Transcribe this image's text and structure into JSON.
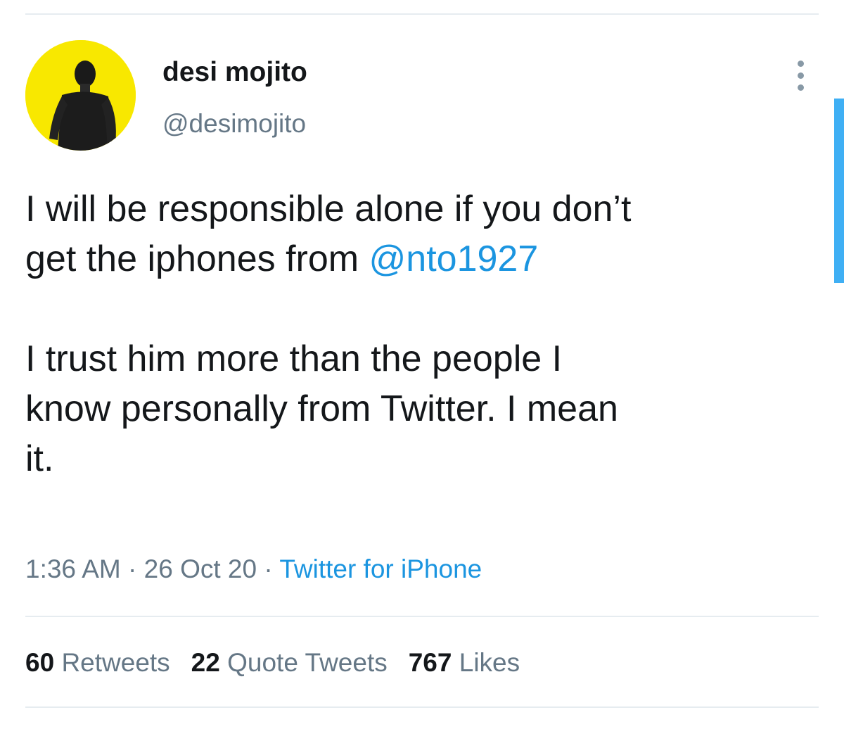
{
  "author": {
    "display_name": "desi mojito",
    "handle": "@desimojito",
    "avatar_icon": "profile-photo",
    "avatar_bg": "#f8e800"
  },
  "menu_icon": "more-vertical-icon",
  "tweet": {
    "line1": "I will be responsible alone if you don’t",
    "line2_prefix": "get the iphones from ",
    "mention": "@nto1927",
    "para2_line1": "I trust him more than the people I",
    "para2_line2": "know personally from Twitter. I mean",
    "para2_line3": "it."
  },
  "meta": {
    "time": "1:36 AM",
    "sep1": " · ",
    "date": "26 Oct 20",
    "sep2": " · ",
    "source": "Twitter for iPhone"
  },
  "stats": {
    "retweets_count": "60",
    "retweets_label": "Retweets",
    "quotes_count": "22",
    "quotes_label": "Quote Tweets",
    "likes_count": "767",
    "likes_label": "Likes"
  },
  "colors": {
    "link": "#1b95e0",
    "secondary_text": "#657786",
    "primary_text": "#14171a",
    "divider": "#e6ecf0"
  }
}
